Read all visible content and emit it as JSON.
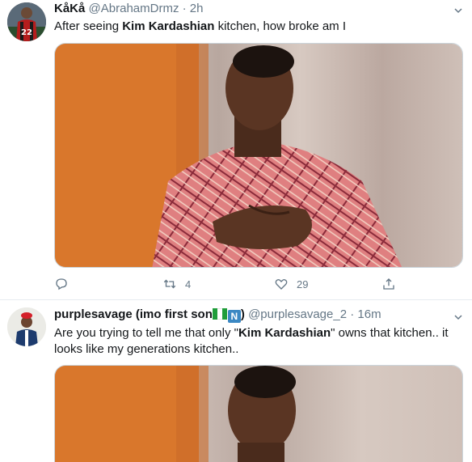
{
  "tweets": [
    {
      "author": {
        "name": "KåKå",
        "handle": "@AbrahamDrmz",
        "separator": "·",
        "time": "2h",
        "avatar_icon": "footballer-avatar-icon"
      },
      "text": {
        "pre": "After seeing ",
        "bold": "Kim Kardashian",
        "post": " kitchen, how broke am I"
      },
      "media": "meme-photo-man-in-patterned-robe",
      "actions": {
        "reply_count": "",
        "retweet_count": "4",
        "like_count": "29",
        "share_count": ""
      }
    },
    {
      "author": {
        "name": "purplesavage (imo first son",
        "name_suffix": ")",
        "flag_emoji": "nigeria-flag-icon",
        "n_emoji": "N",
        "handle": "@purplesavage_2",
        "separator": "·",
        "time": "16m",
        "avatar_icon": "man-in-red-hat-avatar-icon"
      },
      "text": {
        "pre": "Are you trying to tell me that only \"",
        "bold": "Kim Kardashian",
        "post": "\" owns that kitchen.. it looks like my generations kitchen.."
      },
      "media": "meme-photo-man-in-patterned-robe"
    }
  ],
  "colors": {
    "text": "#14171a",
    "secondary": "#657786",
    "border": "#e6ecf0",
    "wall_orange": "#d9772c",
    "curtain": "#c9b8b0",
    "robe": "#d96f72"
  }
}
